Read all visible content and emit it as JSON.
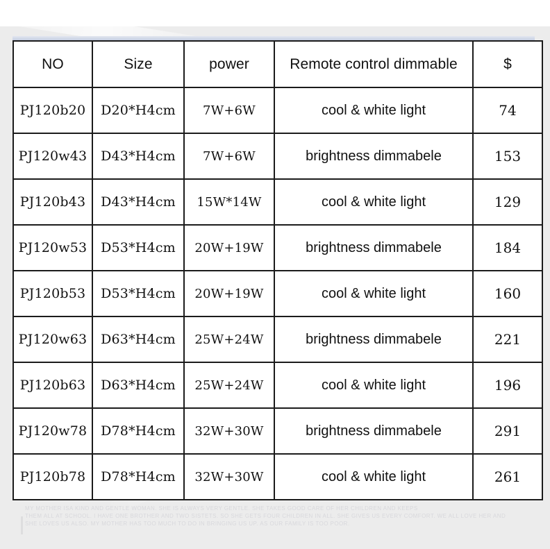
{
  "table": {
    "columns": [
      {
        "key": "no",
        "label": "NO"
      },
      {
        "key": "size",
        "label": "Size"
      },
      {
        "key": "power",
        "label": "power"
      },
      {
        "key": "dim",
        "label": "Remote control dimmable"
      },
      {
        "key": "price",
        "label": "$"
      }
    ],
    "rows": [
      {
        "no": "PJ120b20",
        "size": "D20*H4cm",
        "power": "7W+6W",
        "dim": "cool & white light",
        "price": "74"
      },
      {
        "no": "PJ120w43",
        "size": "D43*H4cm",
        "power": "7W+6W",
        "dim": "brightness dimmabele",
        "price": "153"
      },
      {
        "no": "PJ120b43",
        "size": "D43*H4cm",
        "power": "15W*14W",
        "dim": "cool & white light",
        "price": "129"
      },
      {
        "no": "PJ120w53",
        "size": "D53*H4cm",
        "power": "20W+19W",
        "dim": "brightness dimmabele",
        "price": "184"
      },
      {
        "no": "PJ120b53",
        "size": "D53*H4cm",
        "power": "20W+19W",
        "dim": "cool & white light",
        "price": "160"
      },
      {
        "no": "PJ120w63",
        "size": "D63*H4cm",
        "power": "25W+24W",
        "dim": "brightness dimmabele",
        "price": "221"
      },
      {
        "no": "PJ120b63",
        "size": "D63*H4cm",
        "power": "25W+24W",
        "dim": "cool & white light",
        "price": "196"
      },
      {
        "no": "PJ120w78",
        "size": "D78*H4cm",
        "power": "32W+30W",
        "dim": "brightness dimmabele",
        "price": "291"
      },
      {
        "no": "PJ120b78",
        "size": "D78*H4cm",
        "power": "32W+30W",
        "dim": "cool & white light",
        "price": "261"
      }
    ]
  },
  "footer_note": {
    "line1": "MY MOTHER ISA KIND AND GENTLE WOMAN. SHE IS ALWAYS VERY GENTLE. SHE TAKES GOOD CARE OF HER CHILDREN AND KEEPS",
    "line2": "THEM ALL AT SCHOOL. I HAVE ONE BROTHER AND TWO SISTETS. SO SHE GETS FOUR CHILDREN IN ALL. SHE GIVES US EVERY COMFORT. WE ALL LOVE HER AND",
    "line3": "SHE LOVES US ALSO. MY MOTHER HAS TOO MUCH TO DO IN BRINGING US UP. AS OUR FAMILY IS TOO POOR."
  },
  "colors": {
    "backdrop": "#ececec",
    "table_border": "#1b1b1b",
    "cell_background": "#ffffff",
    "top_band": "#ced6e6",
    "watermark_text": "#d8d8dc"
  }
}
